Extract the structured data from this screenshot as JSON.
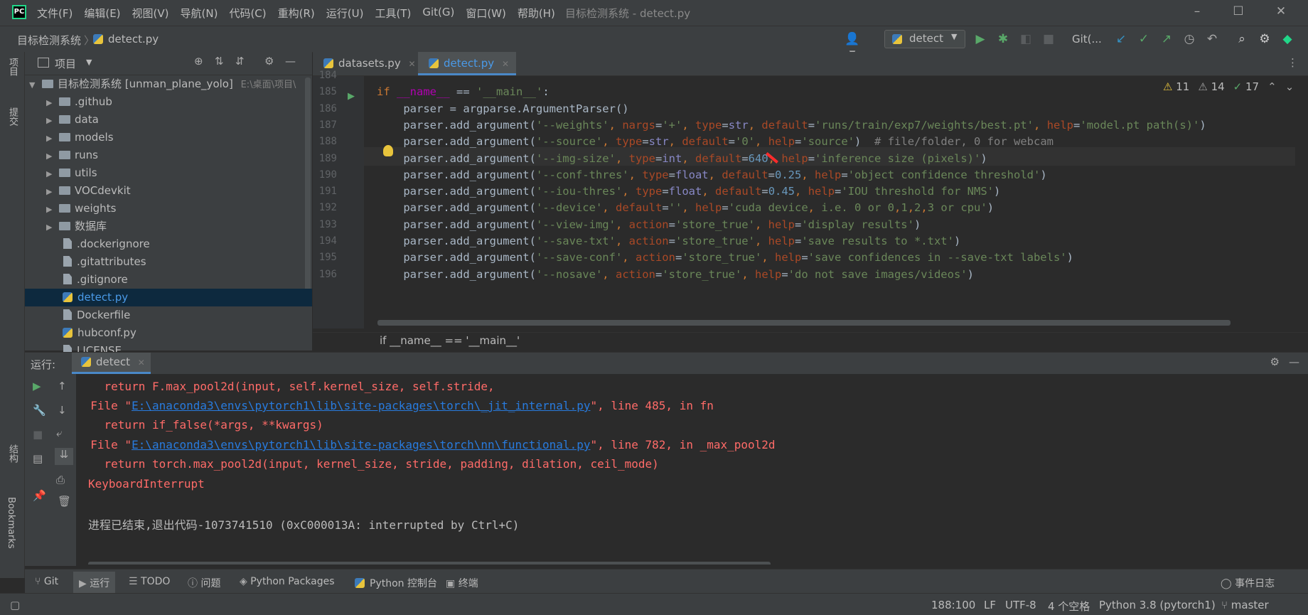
{
  "titlebar": {
    "menu": [
      "文件(F)",
      "编辑(E)",
      "视图(V)",
      "导航(N)",
      "代码(C)",
      "重构(R)",
      "运行(U)",
      "工具(T)",
      "Git(G)",
      "窗口(W)",
      "帮助(H)"
    ],
    "window_title": "目标检测系统 - detect.py"
  },
  "navbar": {
    "project": "目标检测系统",
    "file": "detect.py",
    "run_config": "detect",
    "git_label": "Git(..."
  },
  "left_stripe": {
    "project": "项目",
    "commit": "提交",
    "structure": "结构",
    "bookmarks": "Bookmarks"
  },
  "project_panel": {
    "title": "项目",
    "root": "目标检测系统 [unman_plane_yolo]",
    "root_path": "E:\\桌面\\项目\\",
    "items": [
      {
        "label": ".github",
        "kind": "folder"
      },
      {
        "label": "data",
        "kind": "folder"
      },
      {
        "label": "models",
        "kind": "folder"
      },
      {
        "label": "runs",
        "kind": "folder"
      },
      {
        "label": "utils",
        "kind": "folder"
      },
      {
        "label": "VOCdevkit",
        "kind": "folder"
      },
      {
        "label": "weights",
        "kind": "folder"
      },
      {
        "label": "数据库",
        "kind": "folder"
      },
      {
        "label": ".dockerignore",
        "kind": "file"
      },
      {
        "label": ".gitattributes",
        "kind": "file"
      },
      {
        "label": ".gitignore",
        "kind": "file"
      },
      {
        "label": "detect.py",
        "kind": "py",
        "selected": true
      },
      {
        "label": "Dockerfile",
        "kind": "file"
      },
      {
        "label": "hubconf.py",
        "kind": "py"
      },
      {
        "label": "LICENSE",
        "kind": "file"
      }
    ]
  },
  "editor": {
    "tabs": [
      "datasets.py",
      "detect.py"
    ],
    "active_tab": "detect.py",
    "warnings": "11",
    "weak_warnings": "14",
    "typos": "17",
    "scope_breadcrumb": "if __name__ == '__main__'",
    "lines": [
      {
        "n": "184",
        "text": ""
      },
      {
        "n": "185",
        "text": "if __name__ == '__main__':"
      },
      {
        "n": "186",
        "text": "    parser = argparse.ArgumentParser()"
      },
      {
        "n": "187",
        "text": "    parser.add_argument('--weights', nargs='+', type=str, default='runs/train/exp7/weights/best.pt', help='model.pt path(s)')"
      },
      {
        "n": "188",
        "text": "    parser.add_argument('--source', type=str, default='0', help='source')  # file/folder, 0 for webcam"
      },
      {
        "n": "189",
        "text": "    parser.add_argument('--img-size', type=int, default=640, help='inference size (pixels)')"
      },
      {
        "n": "190",
        "text": "    parser.add_argument('--conf-thres', type=float, default=0.25, help='object confidence threshold')"
      },
      {
        "n": "191",
        "text": "    parser.add_argument('--iou-thres', type=float, default=0.45, help='IOU threshold for NMS')"
      },
      {
        "n": "192",
        "text": "    parser.add_argument('--device', default='', help='cuda device, i.e. 0 or 0,1,2,3 or cpu')"
      },
      {
        "n": "193",
        "text": "    parser.add_argument('--view-img', action='store_true', help='display results')"
      },
      {
        "n": "194",
        "text": "    parser.add_argument('--save-txt', action='store_true', help='save results to *.txt')"
      },
      {
        "n": "195",
        "text": "    parser.add_argument('--save-conf', action='store_true', help='save confidences in --save-txt labels')"
      },
      {
        "n": "196",
        "text": "    parser.add_argument('--nosave', action='store_true', help='do not save images/videos')"
      }
    ]
  },
  "run_panel": {
    "label": "运行:",
    "tab": "detect",
    "console": {
      "l1": "    return F.max_pool2d(input, self.kernel_size, self.stride,",
      "l2_pre": "  File \"",
      "l2_link": "E:\\anaconda3\\envs\\pytorch1\\lib\\site-packages\\torch\\_jit_internal.py",
      "l2_post": "\", line 485, in fn",
      "l3": "    return if_false(*args, **kwargs)",
      "l4_pre": "  File \"",
      "l4_link": "E:\\anaconda3\\envs\\pytorch1\\lib\\site-packages\\torch\\nn\\functional.py",
      "l4_post": "\", line 782, in _max_pool2d",
      "l5": "    return torch.max_pool2d(input, kernel_size, stride, padding, dilation, ceil_mode)",
      "l6": "KeyboardInterrupt",
      "exit": "进程已结束,退出代码-1073741510 (0xC000013A: interrupted by Ctrl+C)"
    }
  },
  "tool_windows": [
    "Git",
    "运行",
    "TODO",
    "问题",
    "Python Packages",
    "Python 控制台",
    "终端"
  ],
  "event_log": "事件日志",
  "statusbar": {
    "position": "188:100",
    "line_sep": "LF",
    "encoding": "UTF-8",
    "indent": "4 个空格",
    "interpreter": "Python 3.8 (pytorch1)",
    "branch": "master"
  }
}
